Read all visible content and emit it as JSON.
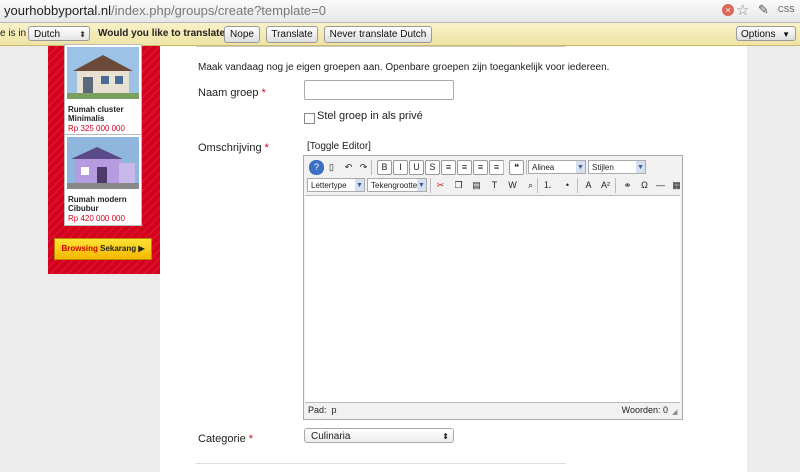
{
  "browser": {
    "url_host": "yourhobbyportal.nl",
    "url_path": "/index.php/groups/create?template=0",
    "ext_label": "CSS"
  },
  "translate_bar": {
    "prefix": "e is in",
    "language": "Dutch",
    "question": "Would you like to translate it?",
    "nope": "Nope",
    "translate": "Translate",
    "never": "Never translate Dutch",
    "options": "Options"
  },
  "sidebar": {
    "listings": [
      {
        "title": "Rumah cluster Minimalis",
        "price": "Rp  325 000 000"
      },
      {
        "title": "Rumah modern Cibubur",
        "price": "Rp 420 000 000"
      }
    ],
    "browse_prefix": "Browsing",
    "browse_label": "Sekarang",
    "browse_arrow": "▶"
  },
  "form": {
    "intro": "Maak vandaag nog je eigen groepen aan. Openbare groepen zijn toegankelijk voor iedereen.",
    "name_label": "Naam groep",
    "required_mark": "*",
    "private_label": "Stel groep in als privé",
    "description_label": "Omschrijving",
    "toggle_editor": "[Toggle Editor]",
    "category_label": "Categorie",
    "category_value": "Culinaria"
  },
  "editor": {
    "format_select": "Alinea",
    "styles_select": "Stijlen",
    "font_select": "Lettertype",
    "size_select": "Tekengrootte",
    "path_label": "Pad:",
    "path_value": "p",
    "word_count": "Woorden: 0",
    "toolbar_row1": [
      {
        "name": "help-icon",
        "glyph": "?"
      },
      {
        "name": "new-document-icon",
        "glyph": "▯"
      },
      {
        "name": "undo-icon",
        "glyph": "↶"
      },
      {
        "name": "redo-icon",
        "glyph": "↷"
      },
      {
        "name": "bold-icon",
        "glyph": "B"
      },
      {
        "name": "italic-icon",
        "glyph": "I"
      },
      {
        "name": "underline-icon",
        "glyph": "U"
      },
      {
        "name": "strikethrough-icon",
        "glyph": "S"
      },
      {
        "name": "align-left-icon",
        "glyph": "≡"
      },
      {
        "name": "align-center-icon",
        "glyph": "≡"
      },
      {
        "name": "align-right-icon",
        "glyph": "≡"
      },
      {
        "name": "align-justify-icon",
        "glyph": "≡"
      },
      {
        "name": "blockquote-icon",
        "glyph": "❝"
      }
    ],
    "toolbar_row2": [
      {
        "name": "cut-icon",
        "glyph": "✂"
      },
      {
        "name": "copy-icon",
        "glyph": "❐"
      },
      {
        "name": "paste-icon",
        "glyph": "▤"
      },
      {
        "name": "paste-text-icon",
        "glyph": "T"
      },
      {
        "name": "paste-word-icon",
        "glyph": "W"
      },
      {
        "name": "find-icon",
        "glyph": "⌕"
      },
      {
        "name": "ordered-list-icon",
        "glyph": "⒈"
      },
      {
        "name": "bullet-list-icon",
        "glyph": "•"
      },
      {
        "name": "text-color-icon",
        "glyph": "A"
      },
      {
        "name": "superscript-icon",
        "glyph": "A²"
      },
      {
        "name": "link-icon",
        "glyph": "⚭"
      },
      {
        "name": "special-char-icon",
        "glyph": "Ω"
      },
      {
        "name": "horizontal-rule-icon",
        "glyph": "—"
      },
      {
        "name": "table-icon",
        "glyph": "▦"
      }
    ],
    "colors": {
      "toolbar_bg": "#f1f1f1",
      "select_arrow": "#3a5a99"
    }
  },
  "colors": {
    "brand_red": "#d4001c",
    "button_yellow": "#f4b800",
    "translate_bar": "#f3e9b3"
  }
}
